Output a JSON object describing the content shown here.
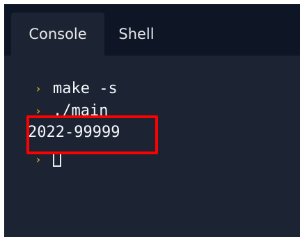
{
  "tabs": [
    {
      "label": "Console",
      "active": true
    },
    {
      "label": "Shell",
      "active": false
    }
  ],
  "console": {
    "prompt_symbol": "›",
    "lines": [
      {
        "type": "command",
        "text": "make -s"
      },
      {
        "type": "command",
        "text": "./main"
      },
      {
        "type": "output",
        "text": "2022-99999"
      },
      {
        "type": "prompt_cursor",
        "text": ""
      }
    ]
  },
  "colors": {
    "background": "#1c2333",
    "tabbar": "#0e1525",
    "prompt": "#c9a227",
    "text": "#f5f9fc",
    "highlight": "#ff0000"
  }
}
